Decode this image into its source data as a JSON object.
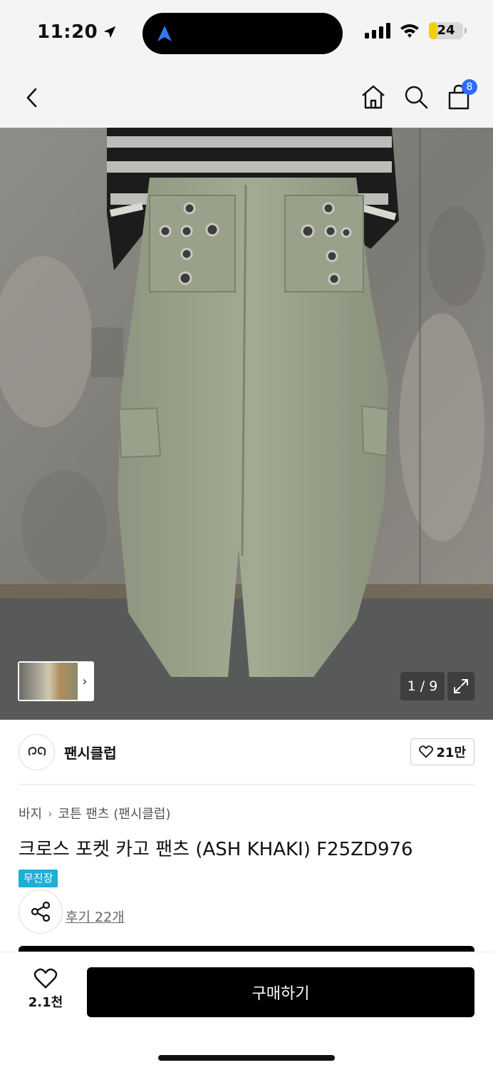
{
  "status_bar": {
    "time": "11:20",
    "battery": "24",
    "battery_level": 0.24,
    "battery_color": "#f2d000"
  },
  "nav": {
    "back_icon": "chevron-left-icon",
    "home_icon": "home-icon",
    "search_icon": "search-icon",
    "cart_icon": "shopping-bag-icon",
    "cart_count": "8",
    "badge_color": "#2f6bff"
  },
  "gallery": {
    "counter": "1 / 9",
    "thumbnail_chevron": "›",
    "expand_icon": "expand-icon"
  },
  "brand": {
    "logo_text": "ꔮ",
    "name": "팬시클럽",
    "like_count": "21만"
  },
  "product": {
    "breadcrumb": [
      "바지",
      "코튼 팬츠 (팬시클럽)"
    ],
    "title": "크로스 포켓 카고 팬츠 (ASH KHAKI) F25ZD976",
    "tag": "무진장",
    "tag_color": "#1faed6",
    "review_link": "후기 22개"
  },
  "bottom_bar": {
    "wish_count": "2.1천",
    "buy_label": "구매하기"
  }
}
